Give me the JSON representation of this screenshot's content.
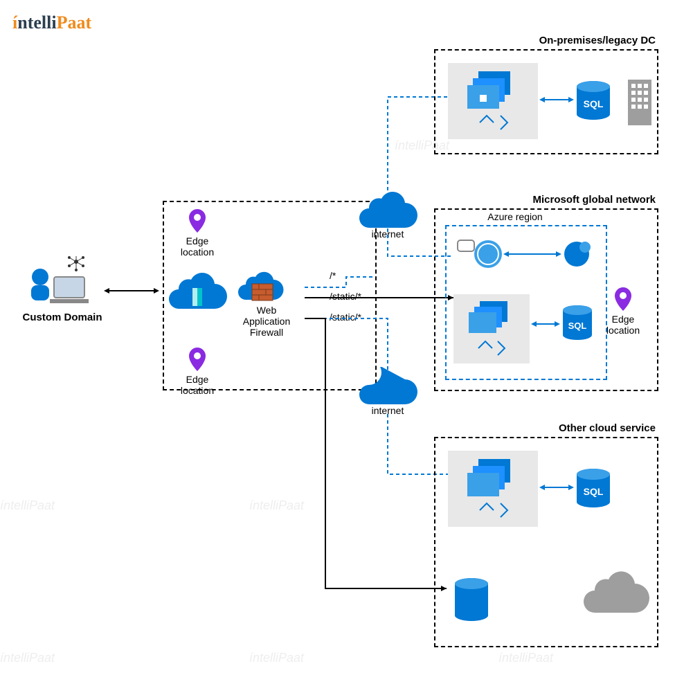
{
  "logo": {
    "text_part1": "ntelli",
    "text_part2": "Paat",
    "accent": "#f08b1d",
    "dark": "#2c3e50"
  },
  "labels": {
    "custom_domain": "Custom Domain",
    "edge_location": "Edge location",
    "waf": "Web Application Firewall",
    "internet": "internet",
    "onprem": "On-premises/legacy DC",
    "ms_global": "Microsoft global network",
    "azure_region": "Azure region",
    "other_cloud": "Other cloud service",
    "sql": "SQL",
    "path_root": "/*",
    "path_static": "/static/*"
  },
  "colors": {
    "azure": "#0078d4",
    "azure_light": "#3aa0e8",
    "gray": "#9e9e9e",
    "brick": "#c75c2e"
  }
}
